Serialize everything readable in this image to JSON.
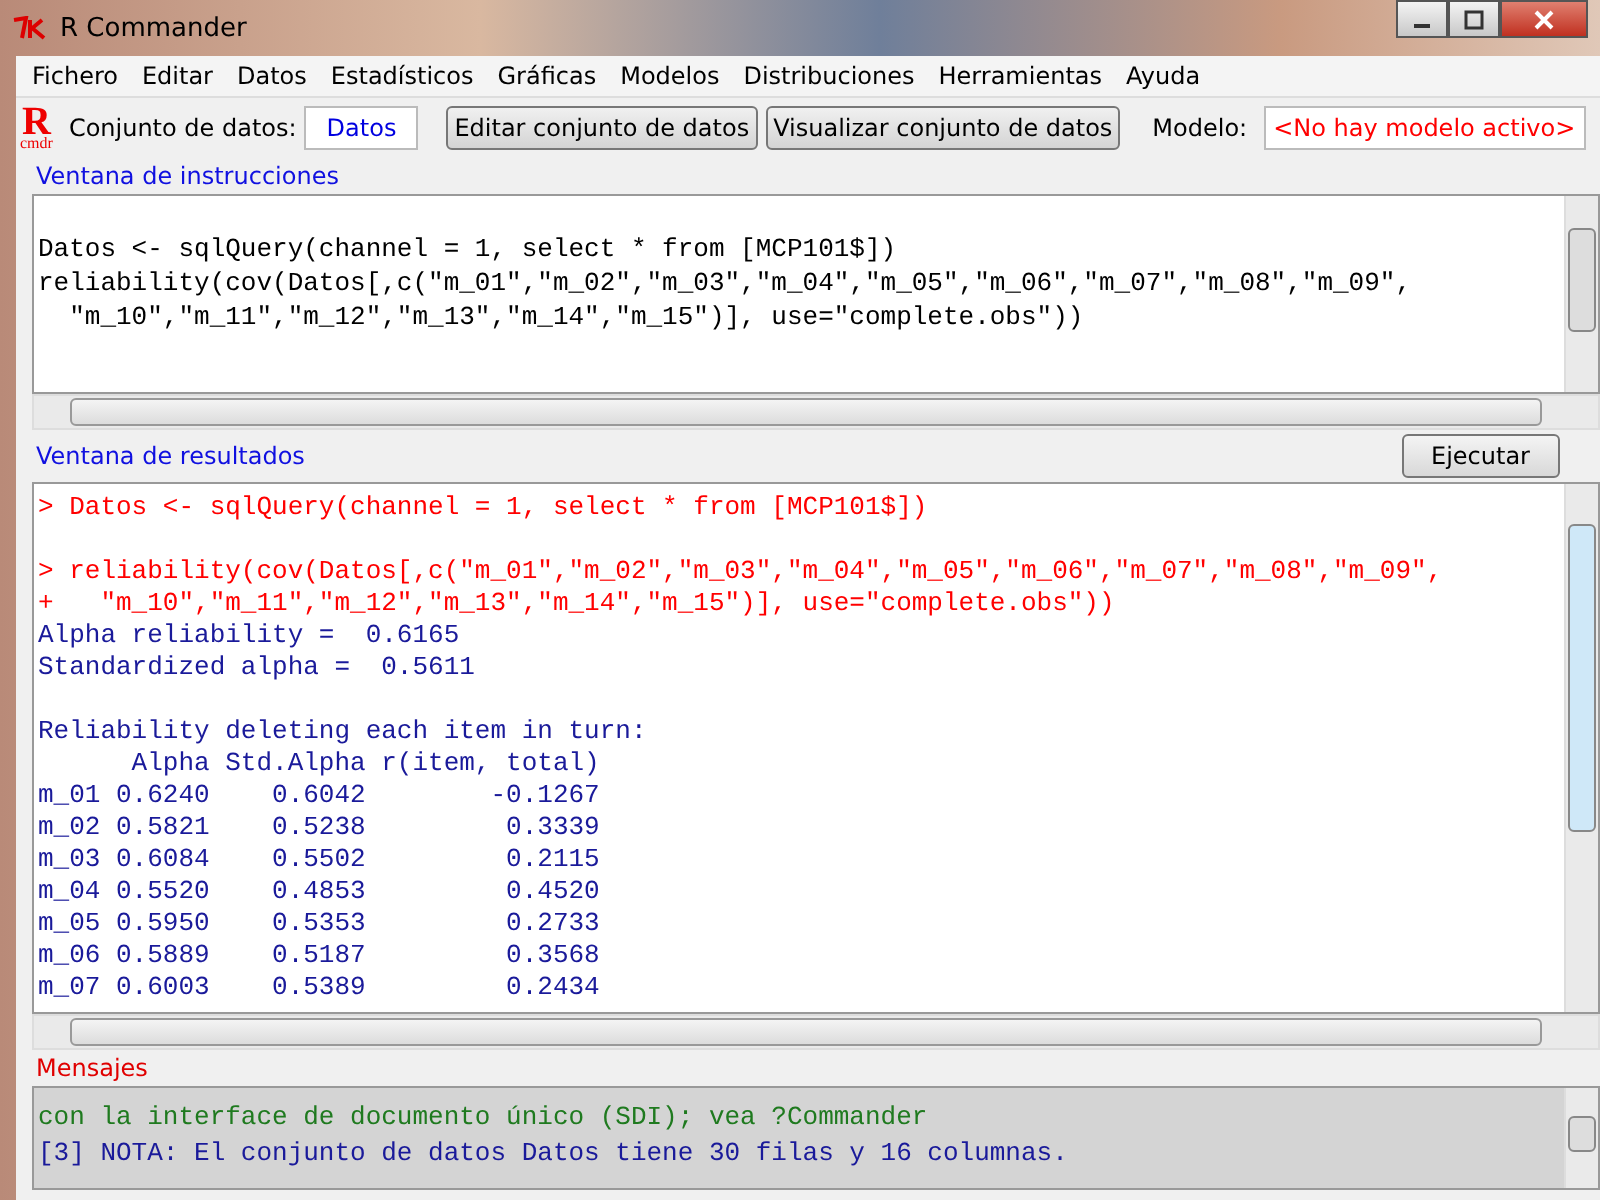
{
  "window": {
    "title": "R Commander"
  },
  "menu": [
    "Fichero",
    "Editar",
    "Datos",
    "Estadísticos",
    "Gráficas",
    "Modelos",
    "Distribuciones",
    "Herramientas",
    "Ayuda"
  ],
  "toolbar": {
    "logo": "R",
    "logo_sub": "cmdr",
    "dataset_label": "Conjunto de datos:",
    "dataset": "Datos",
    "buttons": [
      "Editar conjunto de datos",
      "Visualizar conjunto de datos"
    ],
    "model_label": "Modelo:",
    "model": "<No hay modelo activo>"
  },
  "script_window": {
    "label": "Ventana de instrucciones",
    "lines": [
      "Datos <- sqlQuery(channel = 1, select * from [MCP101$])",
      "reliability(cov(Datos[,c(\"m_01\",\"m_02\",\"m_03\",\"m_04\",\"m_05\",\"m_06\",\"m_07\",\"m_08\",\"m_09\",",
      "  \"m_10\",\"m_11\",\"m_12\",\"m_13\",\"m_14\",\"m_15\")], use=\"complete.obs\"))"
    ]
  },
  "output_window": {
    "label": "Ventana de resultados",
    "run_button": "Ejecutar",
    "lines": [
      {
        "kind": "command",
        "text": "> Datos <- sqlQuery(channel = 1, select * from [MCP101$])"
      },
      {
        "kind": "blank"
      },
      {
        "kind": "command",
        "text": "> reliability(cov(Datos[,c(\"m_01\",\"m_02\",\"m_03\",\"m_04\",\"m_05\",\"m_06\",\"m_07\",\"m_08\",\"m_09\","
      },
      {
        "kind": "command",
        "text": "+   \"m_10\",\"m_11\",\"m_12\",\"m_13\",\"m_14\",\"m_15\")], use=\"complete.obs\"))"
      },
      {
        "kind": "output",
        "text": "Alpha reliability =  0.6165"
      },
      {
        "kind": "output",
        "text": "Standardized alpha =  0.5611"
      },
      {
        "kind": "blank"
      },
      {
        "kind": "output",
        "text": "Reliability deleting each item in turn:"
      },
      {
        "kind": "output",
        "text": "      Alpha Std.Alpha r(item, total)"
      },
      {
        "kind": "output",
        "text": "m_01 0.6240    0.6042        -0.1267"
      },
      {
        "kind": "output",
        "text": "m_02 0.5821    0.5238         0.3339"
      },
      {
        "kind": "output",
        "text": "m_03 0.6084    0.5502         0.2115"
      },
      {
        "kind": "output",
        "text": "m_04 0.5520    0.4853         0.4520"
      },
      {
        "kind": "output",
        "text": "m_05 0.5950    0.5353         0.2733"
      },
      {
        "kind": "output",
        "text": "m_06 0.5889    0.5187         0.3568"
      },
      {
        "kind": "output",
        "text": "m_07 0.6003    0.5389         0.2434"
      }
    ]
  },
  "messages": {
    "label": "Mensajes",
    "lines": [
      {
        "kind": "note",
        "text": "con la interface de documento único (SDI); vea ?Commander"
      },
      {
        "kind": "info",
        "text": "[3] NOTA: El conjunto de datos Datos tiene 30 filas y 16 columnas."
      }
    ]
  }
}
